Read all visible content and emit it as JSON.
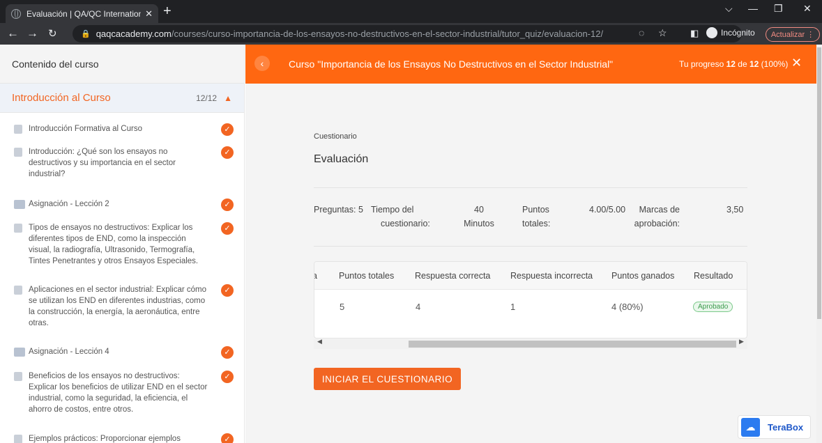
{
  "browser": {
    "tab_title": "Evaluación | QA/QC International",
    "new_tab": "+",
    "url_host": "qaqcacademy.com",
    "url_path": "/courses/curso-importancia-de-los-ensayos-no-destructivos-en-el-sector-industrial/tutor_quiz/evaluacion-12/",
    "incognito_label": "Incógnito",
    "update_label": "Actualizar"
  },
  "sidebar": {
    "header": "Contenido del curso",
    "topic": {
      "name": "Introducción al Curso",
      "count": "12/12"
    },
    "lessons": [
      {
        "title": "Introducción Formativa al Curso",
        "type": "lesson"
      },
      {
        "title": "Introducción: ¿Qué son los ensayos no destructivos y su importancia en el sector industrial?",
        "type": "lesson"
      },
      {
        "title": "Asignación - Lección 2",
        "type": "assignment"
      },
      {
        "title": "Tipos de ensayos no destructivos: Explicar los diferentes tipos de END, como la inspección visual, la radiografía, Ultrasonido, Termografía, Tintes Penetrantes y otros Ensayos Especiales.",
        "type": "lesson"
      },
      {
        "title": "Aplicaciones en el sector industrial: Explicar cómo se utilizan los END en diferentes industrias, como la construcción, la energía, la aeronáutica, entre otras.",
        "type": "lesson"
      },
      {
        "title": "Asignación - Lección 4",
        "type": "assignment"
      },
      {
        "title": "Beneficios de los ensayos no destructivos: Explicar los beneficios de utilizar END en el sector industrial, como la seguridad, la eficiencia, el ahorro de costos, entre otros.",
        "type": "lesson"
      },
      {
        "title": "Ejemplos prácticos: Proporcionar ejemplos",
        "type": "lesson"
      }
    ]
  },
  "header": {
    "course_title": "Curso \"Importancia de los Ensayos No Destructivos en el Sector Industrial\"",
    "progress_prefix": "Tu progreso ",
    "progress_done": "12",
    "progress_of": " de ",
    "progress_total": "12",
    "progress_pct": " (100%)"
  },
  "quiz": {
    "label": "Cuestionario",
    "title": "Evaluación",
    "meta": {
      "questions_label": "Preguntas:",
      "questions_value": "5",
      "time_label_1": "Tiempo del",
      "time_label_2": "cuestionario:",
      "time_value_1": "40",
      "time_value_2": "Minutos",
      "points_label_1": "Puntos",
      "points_label_2": "totales:",
      "points_value": "4.00/5.00",
      "pass_label_1": "Marcas de",
      "pass_label_2": "aprobación:",
      "pass_value": "3,50"
    },
    "table": {
      "headers": [
        "a",
        "Puntos totales",
        "Respuesta correcta",
        "Respuesta incorrecta",
        "Puntos ganados",
        "Resultado"
      ],
      "row": [
        "5",
        "4",
        "1",
        "4 (80%)"
      ],
      "result": "Aprobado"
    },
    "start_button": "INICIAR EL CUESTIONARIO"
  },
  "terabox": "TeraBox",
  "colors": {
    "accent": "#f26522",
    "header_bar": "#ff6711",
    "pass_green": "#3b9b4c"
  }
}
